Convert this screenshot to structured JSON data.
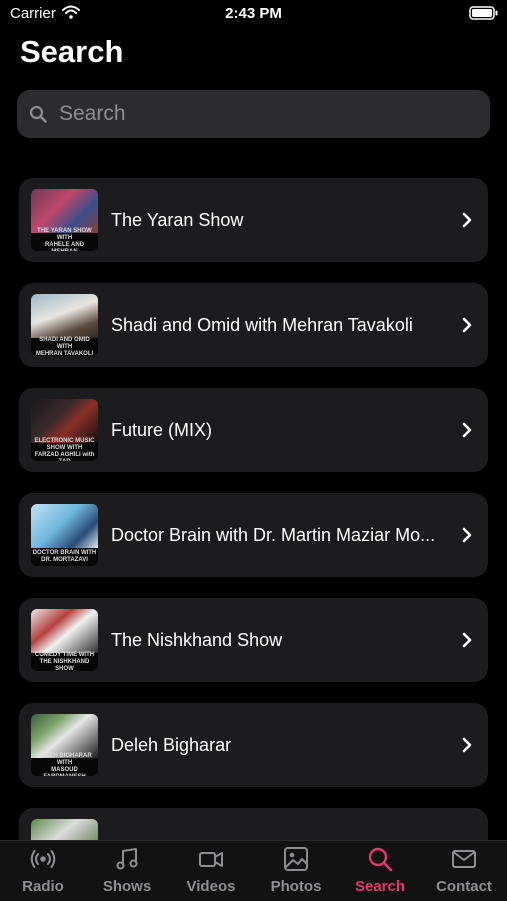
{
  "status_bar": {
    "carrier": "Carrier",
    "time": "2:43 PM"
  },
  "header": {
    "title": "Search"
  },
  "search": {
    "placeholder": "Search"
  },
  "shows": [
    {
      "title": "The Yaran Show",
      "thumb_lines": [
        "THE YARAN SHOW WITH",
        "RAHELE AND MEHRAN"
      ]
    },
    {
      "title": "Shadi and Omid with Mehran Tavakoli",
      "thumb_lines": [
        "SHADI AND OMID WITH",
        "MEHRAN TAVAKOLI"
      ]
    },
    {
      "title": "Future (MIX)",
      "thumb_lines": [
        "ELECTRONIC MUSIC SHOW WITH",
        "FARZAD AGHILI with ZAD"
      ]
    },
    {
      "title": "Doctor Brain with Dr. Martin Maziar Mo...",
      "thumb_lines": [
        "DOCTOR BRAIN WITH",
        "DR. MORTAZAVI"
      ]
    },
    {
      "title": "The Nishkhand Show",
      "thumb_lines": [
        "COMEDY TIME WITH",
        "THE NISHKHAND SHOW"
      ]
    },
    {
      "title": "Deleh Bigharar",
      "thumb_lines": [
        "DELEH BIGHARAR WITH",
        "MASOUD FARDMANESH"
      ]
    },
    {
      "title": "",
      "thumb_lines": [
        "",
        ""
      ]
    }
  ],
  "tabs": [
    {
      "label": "Radio",
      "icon": "radio-icon"
    },
    {
      "label": "Shows",
      "icon": "music-note-icon"
    },
    {
      "label": "Videos",
      "icon": "video-camera-icon"
    },
    {
      "label": "Photos",
      "icon": "photo-icon"
    },
    {
      "label": "Search",
      "icon": "search-icon",
      "active": true
    },
    {
      "label": "Contact",
      "icon": "envelope-icon"
    }
  ],
  "colors": {
    "background": "#000000",
    "card": "#1c1c1e",
    "search_field": "#2c2c2e",
    "accent": "#e5376b",
    "inactive": "#8e8e93"
  }
}
